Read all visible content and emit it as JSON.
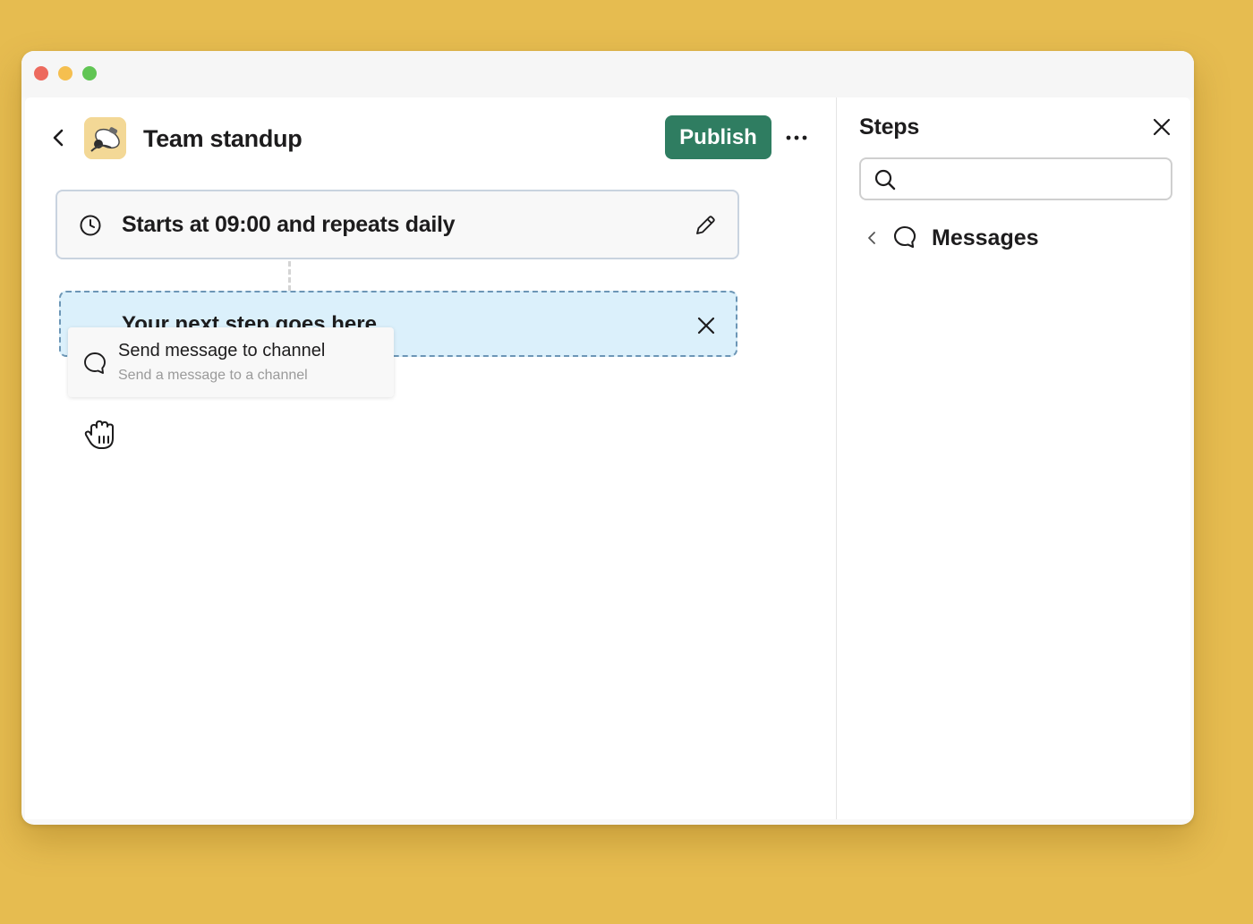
{
  "window": {
    "controls": [
      "close",
      "minimize",
      "zoom"
    ],
    "control_colors": {
      "close": "#ED6A5E",
      "minimize": "#F5BF4F",
      "zoom": "#61C554"
    }
  },
  "header": {
    "back_icon": "chevron-left-icon",
    "workflow_icon": "workflow-image-icon",
    "title": "Team standup",
    "publish_label": "Publish",
    "publish_color": "#2F7D61",
    "more_icon": "ellipsis-icon"
  },
  "canvas": {
    "trigger": {
      "icon": "clock-icon",
      "text": "Starts at 09:00 and repeats daily",
      "edit_icon": "pencil-icon"
    },
    "next_step": {
      "text": "Your next step goes here",
      "close_icon": "close-icon",
      "background": "#DBF0FB"
    },
    "dragging_item": {
      "icon": "message-bubble-icon",
      "title": "Send message to channel",
      "subtitle": "Send a message to a channel"
    }
  },
  "steps_panel": {
    "title": "Steps",
    "close_icon": "close-icon",
    "search": {
      "value": "",
      "placeholder": ""
    },
    "category": {
      "back_icon": "chevron-left-icon",
      "icon": "message-bubble-icon",
      "label": "Messages"
    }
  },
  "colors": {
    "backdrop": "#E6BC50",
    "accent": "#2F7D61"
  }
}
